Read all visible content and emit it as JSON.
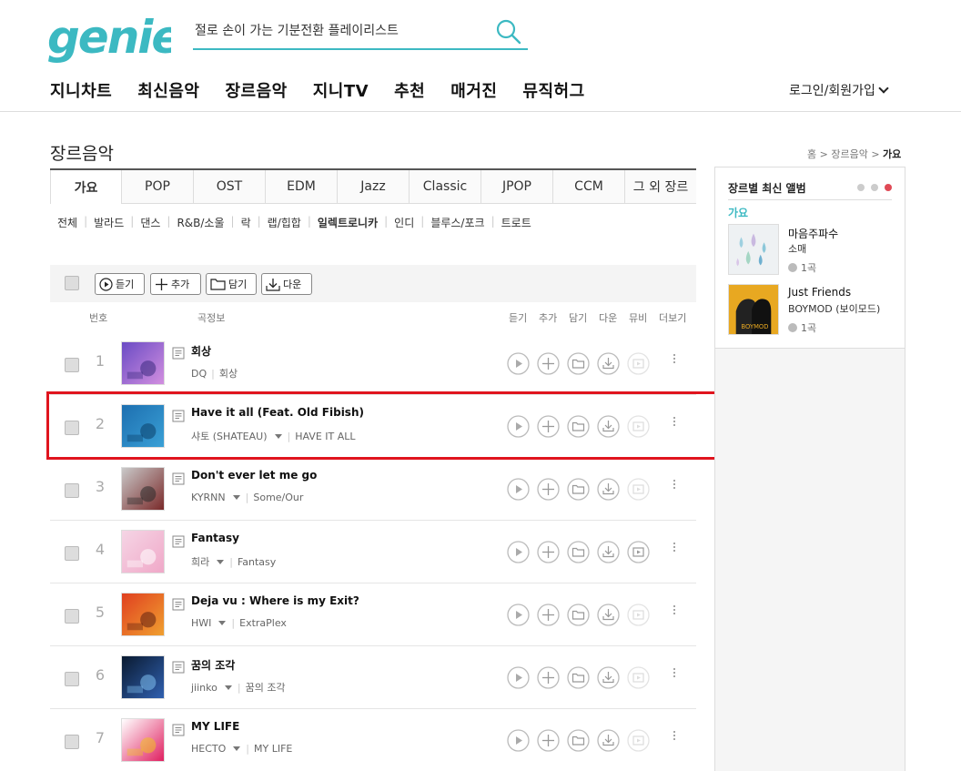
{
  "header": {
    "logo_text": "genie",
    "search_placeholder": "절로 손이 가는 기분전환 플레이리스트",
    "nav": [
      "지니차트",
      "최신음악",
      "장르음악",
      "지니TV",
      "추천",
      "매거진",
      "뮤직허그"
    ],
    "login_label": "로그인/회원가입"
  },
  "page": {
    "title": "장르음악",
    "breadcrumb": [
      "홈",
      "장르음악",
      "가요"
    ]
  },
  "genre_tabs": {
    "items": [
      "가요",
      "POP",
      "OST",
      "EDM",
      "Jazz",
      "Classic",
      "JPOP",
      "CCM",
      "그 외 장르"
    ],
    "active": "가요"
  },
  "subgenres": {
    "items": [
      "전체",
      "발라드",
      "댄스",
      "R&B/소울",
      "락",
      "랩/힙합",
      "일렉트로니카",
      "인디",
      "블루스/포크",
      "트로트"
    ],
    "active": "일렉트로니카"
  },
  "toolbar": {
    "listen": "듣기",
    "add": "추가",
    "save": "담기",
    "download": "다운"
  },
  "columns": {
    "number": "번호",
    "song_info": "곡정보",
    "listen": "듣기",
    "add": "추가",
    "save": "담기",
    "download": "다운",
    "mv": "뮤비",
    "more": "더보기"
  },
  "songs": [
    {
      "rank": "1",
      "title": "회상",
      "artist": "DQ",
      "album": "회상",
      "has_artist_menu": false,
      "mv_available": false
    },
    {
      "rank": "2",
      "title": "Have it all (Feat. Old Fibish)",
      "artist": "샤토 (SHATEAU)",
      "album": "HAVE IT ALL",
      "has_artist_menu": true,
      "mv_available": false
    },
    {
      "rank": "3",
      "title": "Don't ever let me go",
      "artist": "KYRNN",
      "album": "Some/Our",
      "has_artist_menu": true,
      "mv_available": false
    },
    {
      "rank": "4",
      "title": "Fantasy",
      "artist": "희라",
      "album": "Fantasy",
      "has_artist_menu": true,
      "mv_available": true
    },
    {
      "rank": "5",
      "title": "Deja vu : Where is my Exit?",
      "artist": "HWI",
      "album": "ExtraPlex",
      "has_artist_menu": true,
      "mv_available": false
    },
    {
      "rank": "6",
      "title": "꿈의 조각",
      "artist": "jiinko",
      "album": "꿈의 조각",
      "has_artist_menu": true,
      "mv_available": false
    },
    {
      "rank": "7",
      "title": "MY LIFE",
      "artist": "HECTO",
      "album": "MY LIFE",
      "has_artist_menu": true,
      "mv_available": false
    }
  ],
  "sidebar": {
    "title": "장르별 최신 앨범",
    "genre": "가요",
    "albums": [
      {
        "title": "마음주파수",
        "artist": "소매",
        "count": "1곡"
      },
      {
        "title": "Just Friends",
        "artist": "BOYMOD (보이모드)",
        "count": "1곡"
      }
    ]
  },
  "colors": {
    "brand": "#3cb9c2",
    "highlight": "#e0141e"
  }
}
